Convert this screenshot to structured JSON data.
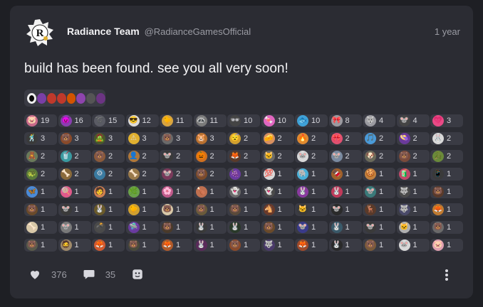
{
  "post": {
    "author_name": "Radiance Team",
    "author_handle": "@RadianceGamesOfficial",
    "time": "1 year",
    "text": "build has been found. see you all very soon!"
  },
  "embed": {
    "icons": [
      "ring",
      "bear",
      "face",
      "eyes",
      "pumpkin",
      "fox",
      "rabbit",
      "ghost"
    ],
    "colors": [
      "#111111",
      "#7a3fa6",
      "#c0392b",
      "#c0392b",
      "#d35400",
      "#8e44ad",
      "#555555",
      "#6c3483"
    ]
  },
  "reactions": [
    {
      "emoji": "🐷",
      "count": "19",
      "bg": "#c96a8a"
    },
    {
      "emoji": "😈",
      "count": "16",
      "bg": "#8a3fb0"
    },
    {
      "emoji": "➰",
      "count": "15",
      "bg": "#5a5b64"
    },
    {
      "emoji": "😎",
      "count": "12",
      "bg": "#dcdcdc"
    },
    {
      "emoji": "🐤",
      "count": "11",
      "bg": "#d8a440"
    },
    {
      "emoji": "🦝",
      "count": "11",
      "bg": "#7a7a7a"
    },
    {
      "emoji": "🕶",
      "count": "10",
      "bg": "#444444"
    },
    {
      "emoji": "🍬",
      "count": "10",
      "bg": "#e066c0"
    },
    {
      "emoji": "🐟",
      "count": "10",
      "bg": "#3fa2d8"
    },
    {
      "emoji": "🎀",
      "count": "8",
      "bg": "#9a9aa0"
    },
    {
      "emoji": "🐺",
      "count": "4",
      "bg": "#9a9aa0"
    },
    {
      "emoji": "🐭",
      "count": "4",
      "bg": "#444444"
    },
    {
      "emoji": "💗",
      "count": "3",
      "bg": "#e84a86"
    },
    {
      "emoji": "🕺",
      "count": "3",
      "bg": "#3a3a3a"
    },
    {
      "emoji": "🐻",
      "count": "3",
      "bg": "#8a4a2a"
    },
    {
      "emoji": "🧟",
      "count": "3",
      "bg": "#4a5a2a"
    },
    {
      "emoji": "⚠",
      "count": "3",
      "bg": "#e0b030"
    },
    {
      "emoji": "🐻",
      "count": "3",
      "bg": "#6a6a6a"
    },
    {
      "emoji": "🐹",
      "count": "3",
      "bg": "#b87030"
    },
    {
      "emoji": "😴",
      "count": "2",
      "bg": "#d0a030"
    },
    {
      "emoji": "🧀",
      "count": "2",
      "bg": "#d89060"
    },
    {
      "emoji": "🔥",
      "count": "2",
      "bg": "#e08a30"
    },
    {
      "emoji": "🎀",
      "count": "2",
      "bg": "#e05070"
    },
    {
      "emoji": "🎵",
      "count": "2",
      "bg": "#4a9ad8"
    },
    {
      "emoji": "👒",
      "count": "2",
      "bg": "#6a3a9a"
    },
    {
      "emoji": "🐰",
      "count": "2",
      "bg": "#d8d8d8"
    },
    {
      "emoji": "🧸",
      "count": "2",
      "bg": "#6a7a5a"
    },
    {
      "emoji": "🥤",
      "count": "2",
      "bg": "#3a9aa0"
    },
    {
      "emoji": "🐻",
      "count": "2",
      "bg": "#8a5a3a"
    },
    {
      "emoji": "👤",
      "count": "2",
      "bg": "#b0783a"
    },
    {
      "emoji": "🐭",
      "count": "2",
      "bg": "#3a3a3a"
    },
    {
      "emoji": "🎃",
      "count": "2",
      "bg": "#d07020"
    },
    {
      "emoji": "🦊",
      "count": "2",
      "bg": "#5a3a2a"
    },
    {
      "emoji": "🐱",
      "count": "2",
      "bg": "#6a6a6a"
    },
    {
      "emoji": "🐭",
      "count": "2",
      "bg": "#d8d8d8"
    },
    {
      "emoji": "🐭",
      "count": "2",
      "bg": "#7a8aa0"
    },
    {
      "emoji": "🐶",
      "count": "2",
      "bg": "#6a6a5a"
    },
    {
      "emoji": "🐻",
      "count": "2",
      "bg": "#7a4a3a"
    },
    {
      "emoji": "🐊",
      "count": "2",
      "bg": "#6a8a3a"
    },
    {
      "emoji": "🐢",
      "count": "2",
      "bg": "#5a7a3a"
    },
    {
      "emoji": "🦴",
      "count": "2",
      "bg": "#8a6a3a"
    },
    {
      "emoji": "⚙",
      "count": "2",
      "bg": "#3a7aa0"
    },
    {
      "emoji": "🦴",
      "count": "2",
      "bg": "#9a7a4a"
    },
    {
      "emoji": "🐭",
      "count": "2",
      "bg": "#7a3a5a"
    },
    {
      "emoji": "🐻",
      "count": "2",
      "bg": "#7a4a2a"
    },
    {
      "emoji": "🍇",
      "count": "1",
      "bg": "#6a3aa0"
    },
    {
      "emoji": "💯",
      "count": "1",
      "bg": "#d8d8d8"
    },
    {
      "emoji": "🐘",
      "count": "1",
      "bg": "#4ab0d8"
    },
    {
      "emoji": "🍫",
      "count": "1",
      "bg": "#a0602a"
    },
    {
      "emoji": "🍪",
      "count": "1",
      "bg": "#c08040"
    },
    {
      "emoji": "🧃",
      "count": "1",
      "bg": "#c04a6a"
    },
    {
      "emoji": "📱",
      "count": "1",
      "bg": "#3a3a3a"
    },
    {
      "emoji": "🦋",
      "count": "1",
      "bg": "#4a8ad8"
    },
    {
      "emoji": "🍭",
      "count": "1",
      "bg": "#e05a8a"
    },
    {
      "emoji": "🧑",
      "count": "1",
      "bg": "#d08050"
    },
    {
      "emoji": "🌿",
      "count": "1",
      "bg": "#6aa04a"
    },
    {
      "emoji": "🌸",
      "count": "1",
      "bg": "#c05a8a"
    },
    {
      "emoji": "🍗",
      "count": "1",
      "bg": "#c07050"
    },
    {
      "emoji": "👻",
      "count": "1",
      "bg": "#6a6a6a"
    },
    {
      "emoji": "👻",
      "count": "1",
      "bg": "#4a4a4a"
    },
    {
      "emoji": "🐰",
      "count": "1",
      "bg": "#8a3aa0"
    },
    {
      "emoji": "🐰",
      "count": "1",
      "bg": "#c03a5a"
    },
    {
      "emoji": "🐭",
      "count": "1",
      "bg": "#3a7a7a"
    },
    {
      "emoji": "🐺",
      "count": "1",
      "bg": "#4a4a4a"
    },
    {
      "emoji": "🐻",
      "count": "1",
      "bg": "#5a3a2a"
    },
    {
      "emoji": "🐻",
      "count": "1",
      "bg": "#6a4a2a"
    },
    {
      "emoji": "🐭",
      "count": "1",
      "bg": "#3a3a3a"
    },
    {
      "emoji": "🐰",
      "count": "1",
      "bg": "#6a5a2a"
    },
    {
      "emoji": "🐤",
      "count": "1",
      "bg": "#d0a030"
    },
    {
      "emoji": "🐻",
      "count": "1",
      "bg": "#d8c8a8"
    },
    {
      "emoji": "🐻",
      "count": "1",
      "bg": "#6a5a3a"
    },
    {
      "emoji": "🐻",
      "count": "1",
      "bg": "#5a4a3a"
    },
    {
      "emoji": "🐴",
      "count": "1",
      "bg": "#6a3a2a"
    },
    {
      "emoji": "🐱",
      "count": "1",
      "bg": "#3a3a3a"
    },
    {
      "emoji": "🐭",
      "count": "1",
      "bg": "#2a2a2a"
    },
    {
      "emoji": "🦌",
      "count": "1",
      "bg": "#5a3a2a"
    },
    {
      "emoji": "🐺",
      "count": "1",
      "bg": "#4a4a6a"
    },
    {
      "emoji": "🦊",
      "count": "1",
      "bg": "#c07a30"
    },
    {
      "emoji": "🦴",
      "count": "1",
      "bg": "#d8c8a8"
    },
    {
      "emoji": "🐭",
      "count": "1",
      "bg": "#7a7a7a"
    },
    {
      "emoji": "💣",
      "count": "1",
      "bg": "#4a4a4a"
    },
    {
      "emoji": "🛸",
      "count": "1",
      "bg": "#6a3aa0"
    },
    {
      "emoji": "🐻",
      "count": "1",
      "bg": "#4a3a2a"
    },
    {
      "emoji": "🐰",
      "count": "1",
      "bg": "#3a3a3a"
    },
    {
      "emoji": "🐰",
      "count": "1",
      "bg": "#2a3a2a"
    },
    {
      "emoji": "🐻",
      "count": "1",
      "bg": "#6a4a2a"
    },
    {
      "emoji": "🐭",
      "count": "1",
      "bg": "#3a3a8a"
    },
    {
      "emoji": "🐰",
      "count": "1",
      "bg": "#3a5a6a"
    },
    {
      "emoji": "🐭",
      "count": "1",
      "bg": "#3a3a3a"
    },
    {
      "emoji": "🐱",
      "count": "1",
      "bg": "#b0b0b0"
    },
    {
      "emoji": "🐻",
      "count": "1",
      "bg": "#6a6a6a"
    },
    {
      "emoji": "🐻",
      "count": "1",
      "bg": "#5a5a4a"
    },
    {
      "emoji": "🧔",
      "count": "1",
      "bg": "#a08a6a"
    },
    {
      "emoji": "🦊",
      "count": "1",
      "bg": "#d05a30"
    },
    {
      "emoji": "🐻",
      "count": "1",
      "bg": "#4a4a3a"
    },
    {
      "emoji": "🦊",
      "count": "1",
      "bg": "#b05a2a"
    },
    {
      "emoji": "🐰",
      "count": "1",
      "bg": "#5a2a5a"
    },
    {
      "emoji": "🐻",
      "count": "1",
      "bg": "#8a4a2a"
    },
    {
      "emoji": "🐺",
      "count": "1",
      "bg": "#4a3a6a"
    },
    {
      "emoji": "🦊",
      "count": "1",
      "bg": "#a04a2a"
    },
    {
      "emoji": "🐰",
      "count": "1",
      "bg": "#2a2a2a"
    },
    {
      "emoji": "🐻",
      "count": "1",
      "bg": "#7a5a3a"
    },
    {
      "emoji": "🐭",
      "count": "1",
      "bg": "#d8d8d8"
    },
    {
      "emoji": "🐷",
      "count": "1",
      "bg": "#e0a0b0"
    }
  ],
  "actions": {
    "likes": "376",
    "comments": "35"
  },
  "colors": {
    "card": "#2b2c33",
    "chip": "#3a3b44",
    "muted": "#9a9ba3"
  }
}
